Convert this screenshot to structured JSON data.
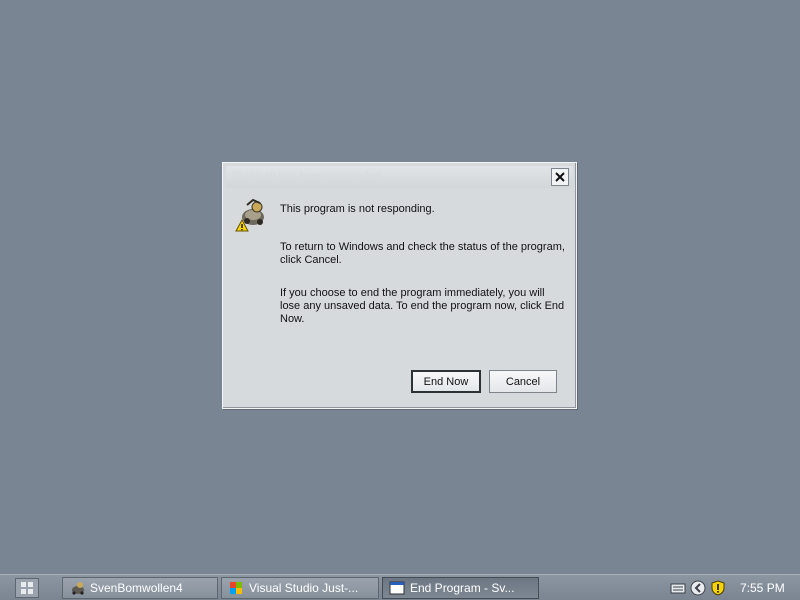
{
  "dialog": {
    "title": "Illuminati has been suspended",
    "close_label": "✕",
    "message_1": "This program is not responding.",
    "message_2": "To return to Windows and check the status of the program, click Cancel.",
    "message_3": "If you choose to end the program immediately, you will lose any unsaved data. To end the program now, click End Now.",
    "end_now_label": "End Now",
    "cancel_label": "Cancel"
  },
  "taskbar": {
    "tasks": [
      {
        "label": "SvenBomwollen4",
        "icon": "app-icon"
      },
      {
        "label": "Visual Studio Just-...",
        "icon": "visual-studio-icon"
      },
      {
        "label": "End Program - Sv...",
        "icon": "window-icon",
        "active": true
      }
    ],
    "clock": "7:55 PM",
    "tray_icons": [
      "keyboard-icon",
      "back-arrow-icon",
      "security-shield-icon"
    ]
  },
  "colors": {
    "desktop": "#7a8593",
    "dialog_bg": "#d7dadd",
    "taskbar": "#7b8592"
  }
}
